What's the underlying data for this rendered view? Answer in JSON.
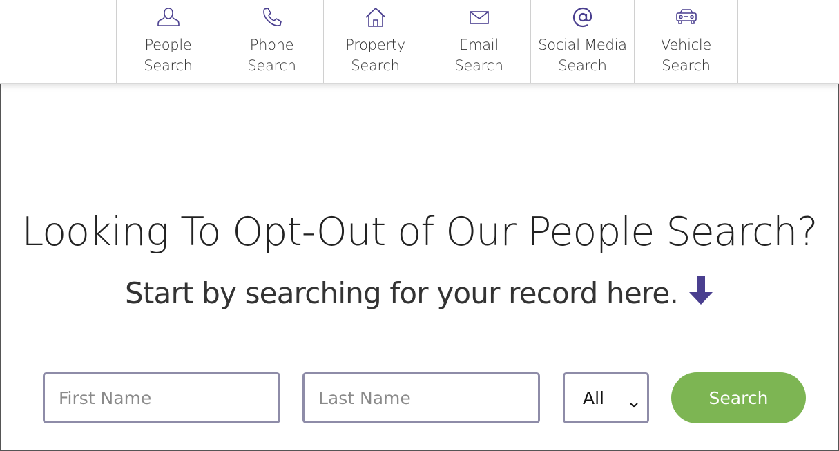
{
  "nav": {
    "items": [
      {
        "line1": "People",
        "line2": "Search",
        "icon": "person-icon"
      },
      {
        "line1": "Phone",
        "line2": "Search",
        "icon": "phone-icon"
      },
      {
        "line1": "Property",
        "line2": "Search",
        "icon": "house-icon"
      },
      {
        "line1": "Email",
        "line2": "Search",
        "icon": "envelope-icon"
      },
      {
        "line1": "Social Media",
        "line2": "Search",
        "icon": "at-sign-icon"
      },
      {
        "line1": "Vehicle",
        "line2": "Search",
        "icon": "car-icon"
      }
    ],
    "icon_color": "#4a3f8f"
  },
  "hero": {
    "headline": "Looking To Opt-Out of Our People Search?",
    "subline": "Start by searching for your record here.",
    "arrow_icon": "arrow-down-icon",
    "arrow_color": "#4a3f8f"
  },
  "form": {
    "first_name_placeholder": "First Name",
    "first_name_value": "",
    "last_name_placeholder": "Last Name",
    "last_name_value": "",
    "state_selected": "All",
    "search_label": "Search",
    "button_color": "#7db553",
    "field_border_color": "#8e8ca8"
  }
}
